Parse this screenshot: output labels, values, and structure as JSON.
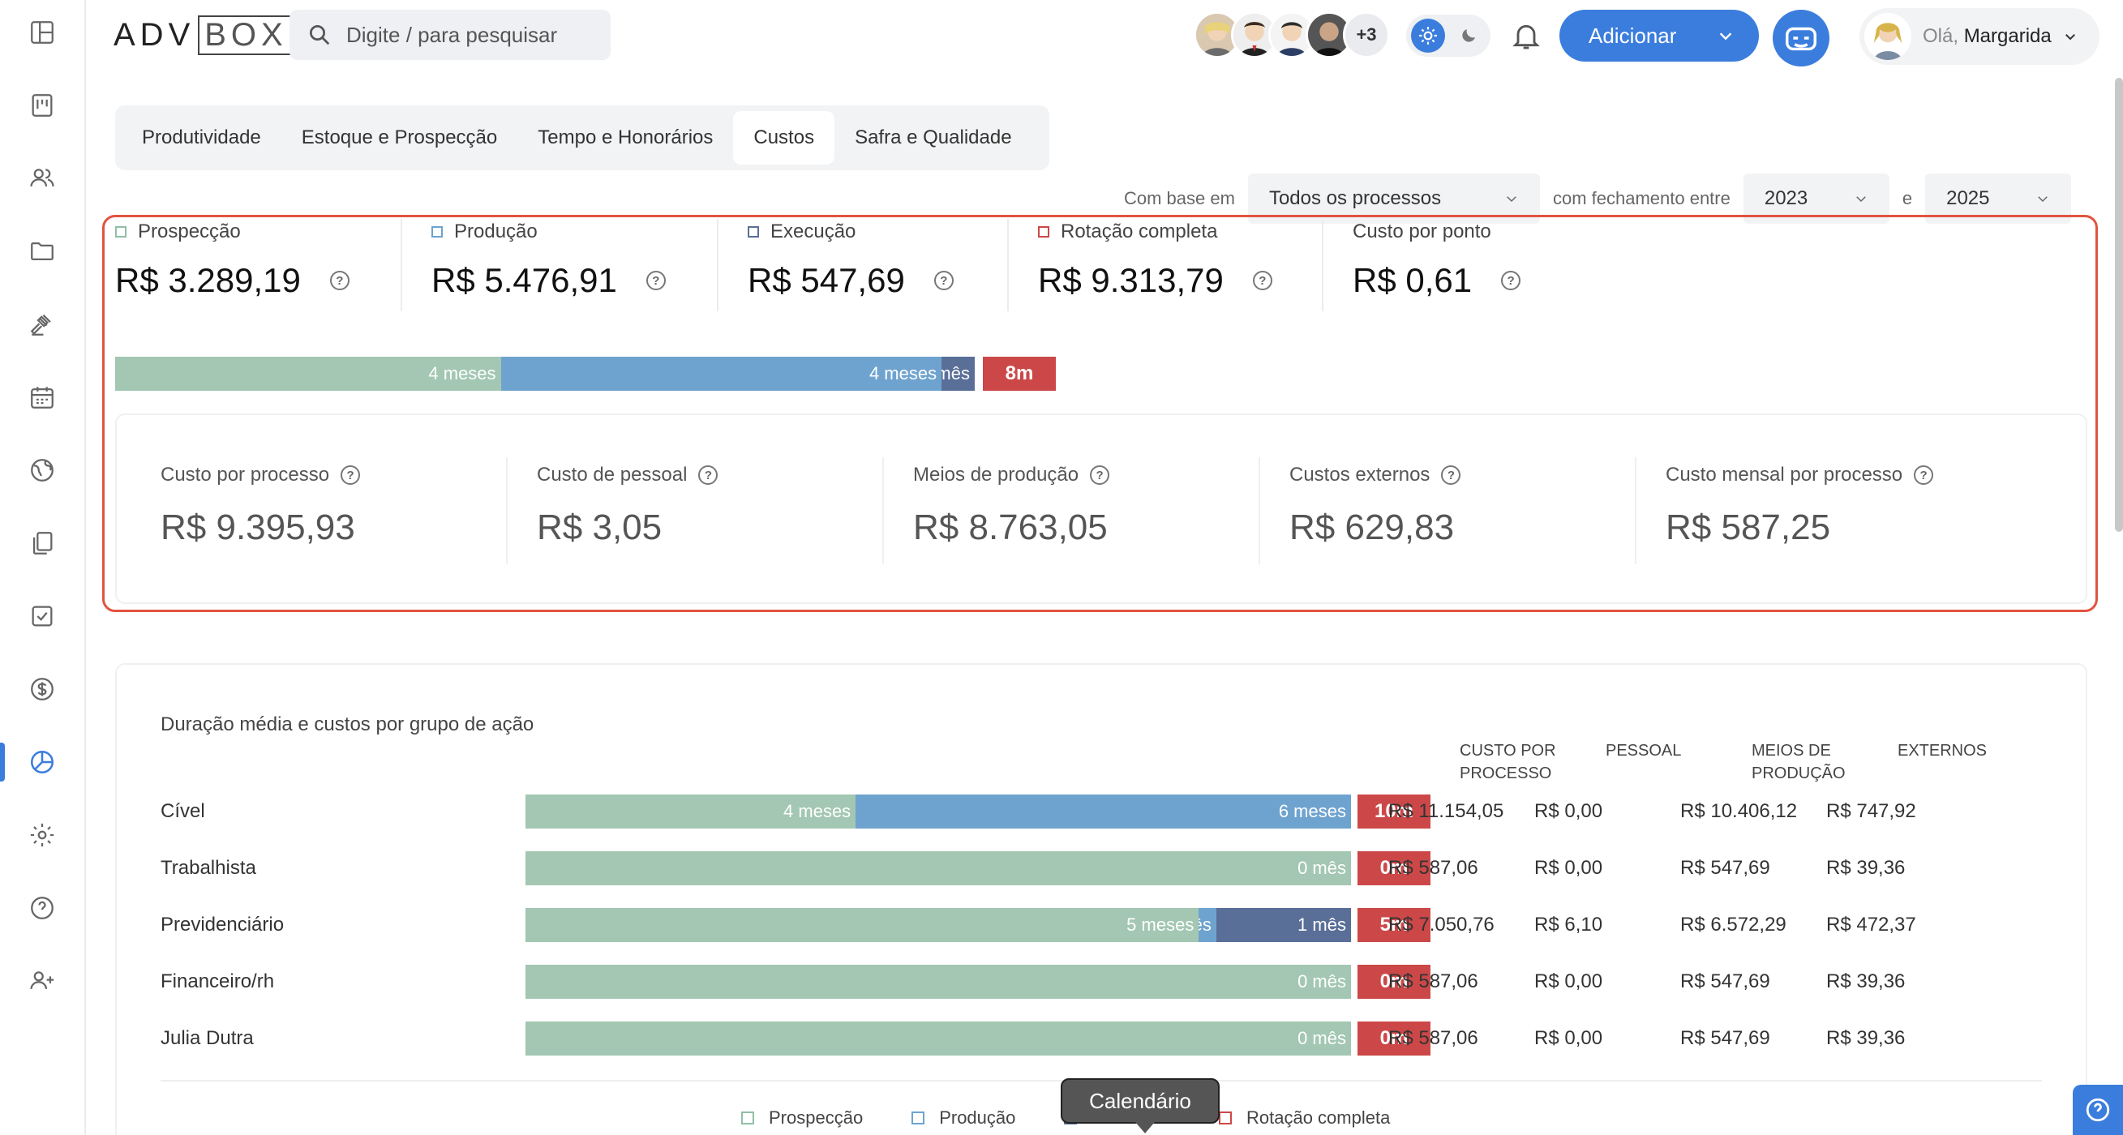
{
  "brand": {
    "logo_left": "ADV",
    "logo_right": "BOX"
  },
  "search": {
    "placeholder": "Digite / para pesquisar"
  },
  "header": {
    "avatars_more": "+3",
    "add_label": "Adicionar",
    "user_hello": "Olá,",
    "user_name": "Margarida"
  },
  "tabs": [
    {
      "label": "Produtividade"
    },
    {
      "label": "Estoque e Prospecção"
    },
    {
      "label": "Tempo e Honorários"
    },
    {
      "label": "Custos"
    },
    {
      "label": "Safra e Qualidade"
    }
  ],
  "active_tab": "Custos",
  "filters": {
    "based_on_label": "Com base em",
    "based_on_value": "Todos os processos",
    "closing_label": "com fechamento entre",
    "year_from": "2023",
    "and_label": "e",
    "year_to": "2025"
  },
  "metrics": [
    {
      "label": "Prospecção",
      "value": "R$ 3.289,19",
      "color": "#8fbfa5"
    },
    {
      "label": "Produção",
      "value": "R$ 5.476,91",
      "color": "#6da3cf"
    },
    {
      "label": "Execução",
      "value": "R$ 547,69",
      "color": "#5a6f98"
    },
    {
      "label": "Rotação completa",
      "value": "R$ 9.313,79",
      "color": "#cc4848"
    },
    {
      "label": "Custo por ponto",
      "value": "R$ 0,61",
      "color": ""
    }
  ],
  "timeline": {
    "prospeccao": {
      "label": "4 meses",
      "months": 4
    },
    "producao": {
      "label": "4 meses",
      "months": 4
    },
    "execucao": {
      "label": "1 mês",
      "months": 1
    },
    "total": "8m"
  },
  "cost_stats": [
    {
      "label": "Custo por processo",
      "value": "R$ 9.395,93"
    },
    {
      "label": "Custo de pessoal",
      "value": "R$ 3,05"
    },
    {
      "label": "Meios de produção",
      "value": "R$ 8.763,05"
    },
    {
      "label": "Custos externos",
      "value": "R$ 629,83"
    },
    {
      "label": "Custo mensal por processo",
      "value": "R$ 587,25"
    }
  ],
  "groups": {
    "title": "Duração média e custos por grupo de ação",
    "headers": [
      "CUSTO POR PROCESSO",
      "PESSOAL",
      "MEIOS DE PRODUÇÃO",
      "EXTERNOS"
    ],
    "rows": [
      {
        "name": "Cível",
        "p": 4,
        "pl": "4 meses",
        "pr": 6,
        "prl": "6 meses",
        "e": 0,
        "el": "",
        "total": "10m",
        "custo": "R$ 11.154,05",
        "pessoal": "R$ 0,00",
        "meios": "R$ 10.406,12",
        "externos": "R$ 747,92"
      },
      {
        "name": "Trabalhista",
        "p": 0,
        "pl": "0 mês",
        "pr": 0,
        "prl": "",
        "e": 0,
        "el": "",
        "total": "0m",
        "custo": "R$ 587,06",
        "pessoal": "R$ 0,00",
        "meios": "R$ 547,69",
        "externos": "R$ 39,36"
      },
      {
        "name": "Previdenciário",
        "p": 5,
        "pl": "5 meses",
        "pr": 0.13,
        "prl": "1 mês",
        "e": 1,
        "el": "1 mês",
        "total": "5m",
        "custo": "R$ 7.050,76",
        "pessoal": "R$ 6,10",
        "meios": "R$ 6.572,29",
        "externos": "R$ 472,37"
      },
      {
        "name": "Financeiro/rh",
        "p": 0,
        "pl": "0 mês",
        "pr": 0,
        "prl": "",
        "e": 0,
        "el": "",
        "total": "0m",
        "custo": "R$ 587,06",
        "pessoal": "R$ 0,00",
        "meios": "R$ 547,69",
        "externos": "R$ 39,36"
      },
      {
        "name": "Julia Dutra",
        "p": 0,
        "pl": "0 mês",
        "pr": 0,
        "prl": "",
        "e": 0,
        "el": "",
        "total": "0m",
        "custo": "R$ 587,06",
        "pessoal": "R$ 0,00",
        "meios": "R$ 547,69",
        "externos": "R$ 39,36"
      }
    ]
  },
  "legend": [
    "Prospecção",
    "Produção",
    "Execução",
    "Rotação completa"
  ],
  "tooltip": "Calendário",
  "colors": {
    "prospeccao": "#a3c7b2",
    "producao": "#6fa3cf",
    "execucao": "#5a6f98",
    "rotacao": "#cc4848",
    "accent": "#3b7ddd"
  }
}
